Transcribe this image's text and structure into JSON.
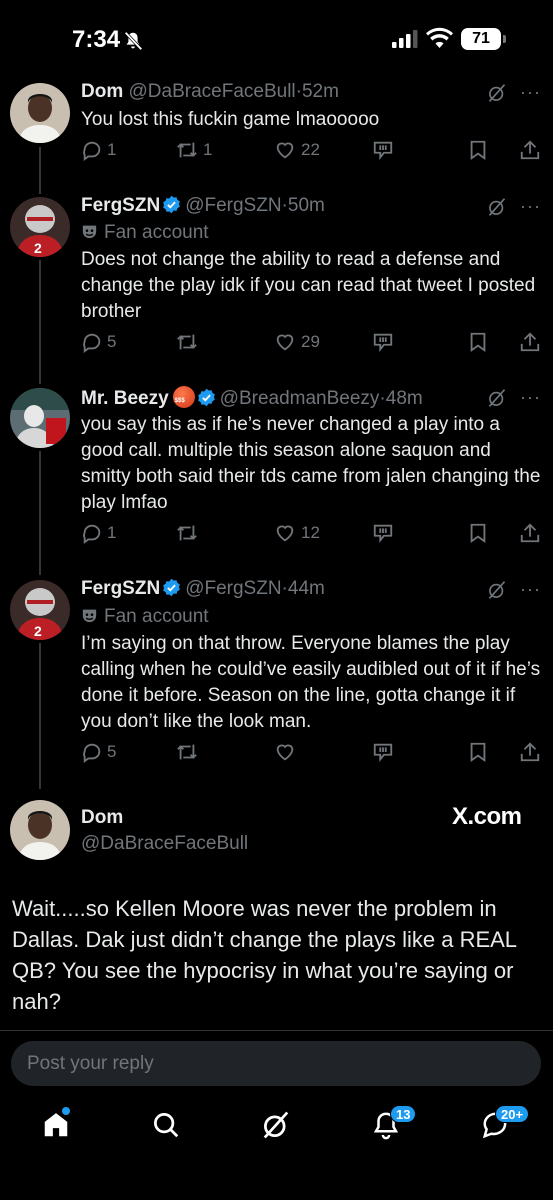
{
  "status_bar": {
    "time": "7:34",
    "battery": "71"
  },
  "tweets": [
    {
      "name": "Dom",
      "handle": "@DaBraceFaceBull",
      "time": "52m",
      "fan_account": "",
      "text": "You lost this fuckin game lmaooooo",
      "replies": "1",
      "reposts": "1",
      "likes": "22"
    },
    {
      "name": "FergSZN",
      "handle": "@FergSZN",
      "time": "50m",
      "fan_account": "Fan account",
      "text": "Does not change the ability to read a defense and change the play idk if you can read that tweet I posted brother",
      "replies": "5",
      "reposts": "",
      "likes": "29"
    },
    {
      "name": "Mr. Beezy",
      "handle": "@BreadmanBeezy",
      "time": "48m",
      "fan_account": "",
      "text": "you say this as if he’s never changed a play into a good call. multiple this season alone saquon and smitty both said their tds came from jalen changing the play lmfao",
      "replies": "1",
      "reposts": "",
      "likes": "12"
    },
    {
      "name": "FergSZN",
      "handle": "@FergSZN",
      "time": "44m",
      "fan_account": "Fan account",
      "text": "I’m saying on that throw. Everyone blames the play calling when he could’ve easily audibled out of it if he’s done it before. Season on the line, gotta change it if you don’t like the look man.",
      "replies": "5",
      "reposts": "",
      "likes": ""
    }
  ],
  "main_tweet": {
    "name": "Dom",
    "handle": "@DaBraceFaceBull",
    "watermark": "X.com",
    "text": "Wait.....so Kellen Moore was never the problem in Dallas. Dak just didn’t change the plays like a REAL QB? You see the hypocrisy in what you’re saying or nah?"
  },
  "reply_box": {
    "placeholder": "Post your reply"
  },
  "bottom_nav": {
    "notifications_badge": "13",
    "messages_badge": "20+"
  },
  "colors": {
    "background": "#000000",
    "accent": "#1d9bf0",
    "muted": "#71767b",
    "text": "#e7e9ea"
  },
  "icons": [
    "mute-icon",
    "signal-icon",
    "wifi-icon",
    "battery-icon",
    "grok-icon",
    "more-icon",
    "reply-icon",
    "repost-icon",
    "like-icon",
    "grok-actions-icon",
    "bookmark-icon",
    "share-icon",
    "verified-icon",
    "fan-account-icon",
    "home-icon",
    "search-icon",
    "grok-nav-icon",
    "notifications-icon",
    "messages-icon"
  ]
}
